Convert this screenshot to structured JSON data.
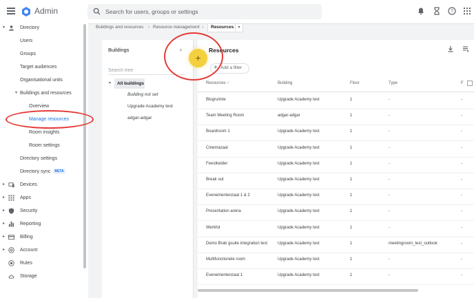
{
  "app": {
    "title": "Admin"
  },
  "search": {
    "placeholder": "Search for users, groups or settings"
  },
  "icons": {
    "menu": "hamburger-menu-icon",
    "logo": "admin-logo-hexagon",
    "search": "search-icon",
    "notifications": "bell-icon",
    "timer": "hourglass-icon",
    "help": "help-circle-icon",
    "apps": "apps-grid-icon"
  },
  "colors": {
    "accent": "#1a73e8",
    "annotation": "#e53935",
    "fab": "#f4d03f"
  },
  "sidebar": {
    "directory": "Directory",
    "users": "Users",
    "groups": "Groups",
    "target_audiences": "Target audiences",
    "org_units": "Organisational units",
    "buildings": "Buildings and resources",
    "overview": "Overview",
    "manage_resources": "Manage resources",
    "room_insights": "Room insights",
    "room_settings": "Room settings",
    "directory_settings": "Directory settings",
    "directory_sync": "Directory sync",
    "beta": "BETA",
    "devices": "Devices",
    "apps": "Apps",
    "security": "Security",
    "reporting": "Reporting",
    "billing": "Billing",
    "account": "Account",
    "rules": "Rules",
    "storage": "Storage"
  },
  "breadcrumb": {
    "item1": "Buildings and resources",
    "item2": "Resource management",
    "current": "Resources"
  },
  "buildings_panel": {
    "title": "Buildings",
    "search_placeholder": "Search tree",
    "all": "All buildings",
    "not_set": "Building not set",
    "item1": "Upgrade Academy test",
    "item2": "adgar-adgar"
  },
  "resources": {
    "title": "Resources",
    "add_filter": "Add a filter",
    "fab": "+",
    "columns": {
      "resources": "Resources",
      "building": "Building",
      "floor": "Floor",
      "type": "Type",
      "f": "F"
    },
    "rows": [
      {
        "name": "Blogruimte",
        "building": "Upgrade Academy test",
        "floor": "1",
        "type": "-",
        "f": "-"
      },
      {
        "name": "Team Meeting Room",
        "building": "adgar-adgar",
        "floor": "1",
        "type": "-",
        "f": "-"
      },
      {
        "name": "Boardroom 1",
        "building": "Upgrade Academy test",
        "floor": "1",
        "type": "-",
        "f": "-"
      },
      {
        "name": "Cinemazaal",
        "building": "Upgrade Academy test",
        "floor": "1",
        "type": "-",
        "f": "-"
      },
      {
        "name": "Feestkelder",
        "building": "Upgrade Academy test",
        "floor": "1",
        "type": "-",
        "f": "-"
      },
      {
        "name": "Break out",
        "building": "Upgrade Academy test",
        "floor": "1",
        "type": "-",
        "f": "-"
      },
      {
        "name": "Evenementenzaal 1 & 2",
        "building": "Upgrade Academy test",
        "floor": "1",
        "type": "-",
        "f": "-"
      },
      {
        "name": "Presentation arena",
        "building": "Upgrade Academy test",
        "floor": "1",
        "type": "-",
        "f": "-"
      },
      {
        "name": "Werkfot",
        "building": "Upgrade Academy test",
        "floor": "1",
        "type": "-",
        "f": "-"
      },
      {
        "name": "Demo Brab gsuite integration test",
        "building": "Upgrade Academy test",
        "floor": "1",
        "type": "meetingroom_test_outlook",
        "f": "-"
      },
      {
        "name": "Multifunctionele room",
        "building": "Upgrade Academy test",
        "floor": "1",
        "type": "-",
        "f": "-"
      },
      {
        "name": "Evenementenzaal 1",
        "building": "Upgrade Academy test",
        "floor": "1",
        "type": "-",
        "f": "-"
      }
    ]
  }
}
